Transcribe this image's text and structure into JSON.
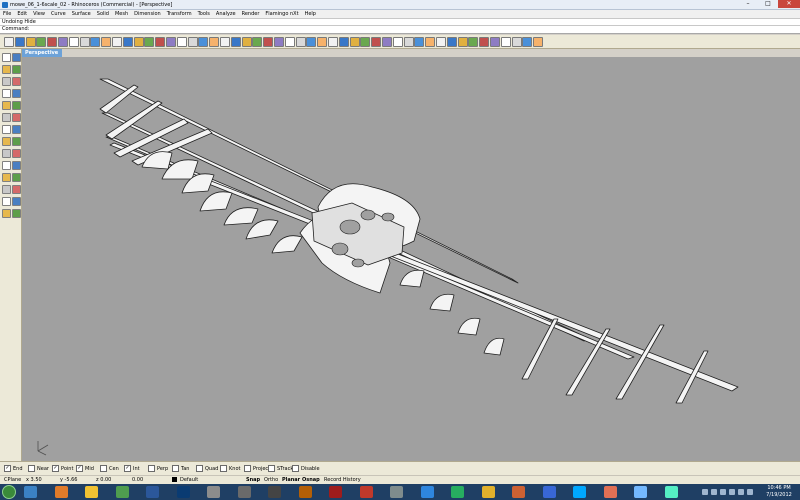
{
  "window": {
    "title": "mowe_06_1-6scale_02 - Rhinoceros (Commercial) - [Perspective]",
    "controls": {
      "minimize": "–",
      "maximize": "□",
      "close": "✕"
    }
  },
  "menu": [
    "File",
    "Edit",
    "View",
    "Curve",
    "Surface",
    "Solid",
    "Mesh",
    "Dimension",
    "Transform",
    "Tools",
    "Analyze",
    "Render",
    "Flamingo nXt",
    "Help"
  ],
  "command_history": "Undoing Hide",
  "command_prompt": "Command:",
  "viewport": {
    "tab_label": "Perspective",
    "background": "#a0a0a0"
  },
  "toolbar_icons": [
    "new-icon",
    "open-icon",
    "save-icon",
    "print-icon",
    "import-icon",
    "cut-icon",
    "copy-icon",
    "paste-icon",
    "undo-icon",
    "redo-icon",
    "pan-icon",
    "rotate-view-icon",
    "zoom-icon",
    "zoom-window-icon",
    "zoom-extents-icon",
    "zoom-selected-icon",
    "select-icon",
    "viewport-layout-icon",
    "grid-icon",
    "cplane-icon",
    "layer-icon",
    "lights-icon",
    "render-icon",
    "material-icon",
    "shade-icon",
    "rendered-icon",
    "environment-icon",
    "sun-icon",
    "camera-icon",
    "properties-icon",
    "points-on-icon",
    "points-off-icon",
    "analyze-icon",
    "snap-icon",
    "group-icon",
    "block-icon",
    "options-icon",
    "help-icon",
    "history-icon",
    "mesh-icon",
    "dim-icon",
    "curve-tool-icon",
    "surface-tool-icon",
    "solid-tool-icon",
    "transform-icon",
    "array-icon",
    "box-icon",
    "sphere-icon",
    "layer-state-icon",
    "named-view-icon"
  ],
  "sidebar_icons": [
    "select-arrow-icon",
    "point-icon",
    "polyline-icon",
    "curve-icon",
    "circle-icon",
    "arc-icon",
    "ellipse-icon",
    "rectangle-icon",
    "polygon-icon",
    "text-icon",
    "surface-icon",
    "extrude-icon",
    "box-icon",
    "sphere-icon",
    "boolean-icon",
    "fillet-icon",
    "move-icon",
    "scale-icon",
    "mirror-icon",
    "array-icon",
    "split-icon",
    "trim-icon",
    "join-icon",
    "explode-icon",
    "analyze-icon",
    "dim-icon",
    "render-icon",
    "mesh-icon"
  ],
  "osnaps": [
    {
      "label": "End",
      "checked": true
    },
    {
      "label": "Near",
      "checked": false
    },
    {
      "label": "Point",
      "checked": true
    },
    {
      "label": "Mid",
      "checked": true
    },
    {
      "label": "Cen",
      "checked": false
    },
    {
      "label": "Int",
      "checked": true
    },
    {
      "label": "Perp",
      "checked": false
    },
    {
      "label": "Tan",
      "checked": false
    },
    {
      "label": "Quad",
      "checked": false
    },
    {
      "label": "Knot",
      "checked": false
    },
    {
      "label": "Project",
      "checked": false
    },
    {
      "label": "STrack",
      "checked": false
    },
    {
      "label": "Disable",
      "checked": false
    }
  ],
  "status": {
    "cplane": "CPlane",
    "x": "x 3.50",
    "y": "y -5.66",
    "z": "z 0.00",
    "dist": "0.00",
    "layer": "Default",
    "snap": "Snap",
    "ortho": "Ortho",
    "planar": "Planar",
    "osnap": "Osnap",
    "record_history": "Record History"
  },
  "clock": {
    "time": "10:46 PM",
    "date": "7/19/2012"
  },
  "taskbar_icons": [
    "ie-icon",
    "firefox-icon",
    "explorer-icon",
    "media-icon",
    "word-icon",
    "photoshop-icon",
    "app-icon",
    "zbrush-icon",
    "unity-icon",
    "illustrator-icon",
    "rhino-icon",
    "acrobat-icon",
    "stylus-icon",
    "chrome-icon",
    "network-icon",
    "folder-icon",
    "notes-icon",
    "calc-icon",
    "skype-icon",
    "vlc-icon",
    "viewer-icon",
    "paint-icon"
  ]
}
